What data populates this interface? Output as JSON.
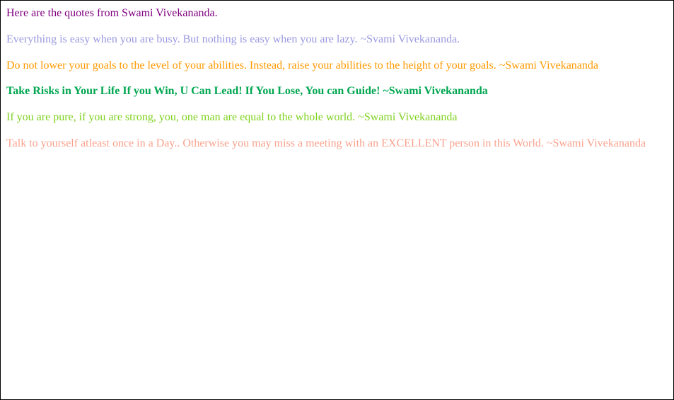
{
  "intro": "Here are the quotes from Swami Vivekananda.",
  "quotes": [
    "Everything is easy when you are busy. But nothing is easy when you are lazy. ~Svami Vivekananda.",
    "Do not lower your goals to the level of your abilities. Instead, raise your abilities to the height of your goals. ~Swami Vivekananda",
    "Take Risks in Your Life If you Win, U Can Lead! If You Lose, You can Guide! ~Swami Vivekananda",
    "If you are pure, if you are strong, you, one man are equal to the whole world. ~Swami Vivekananda",
    "Talk to yourself atleast once in a Day.. Otherwise you may miss a meeting with an EXCELLENT person in this World. ~Swami Vivekananda"
  ]
}
